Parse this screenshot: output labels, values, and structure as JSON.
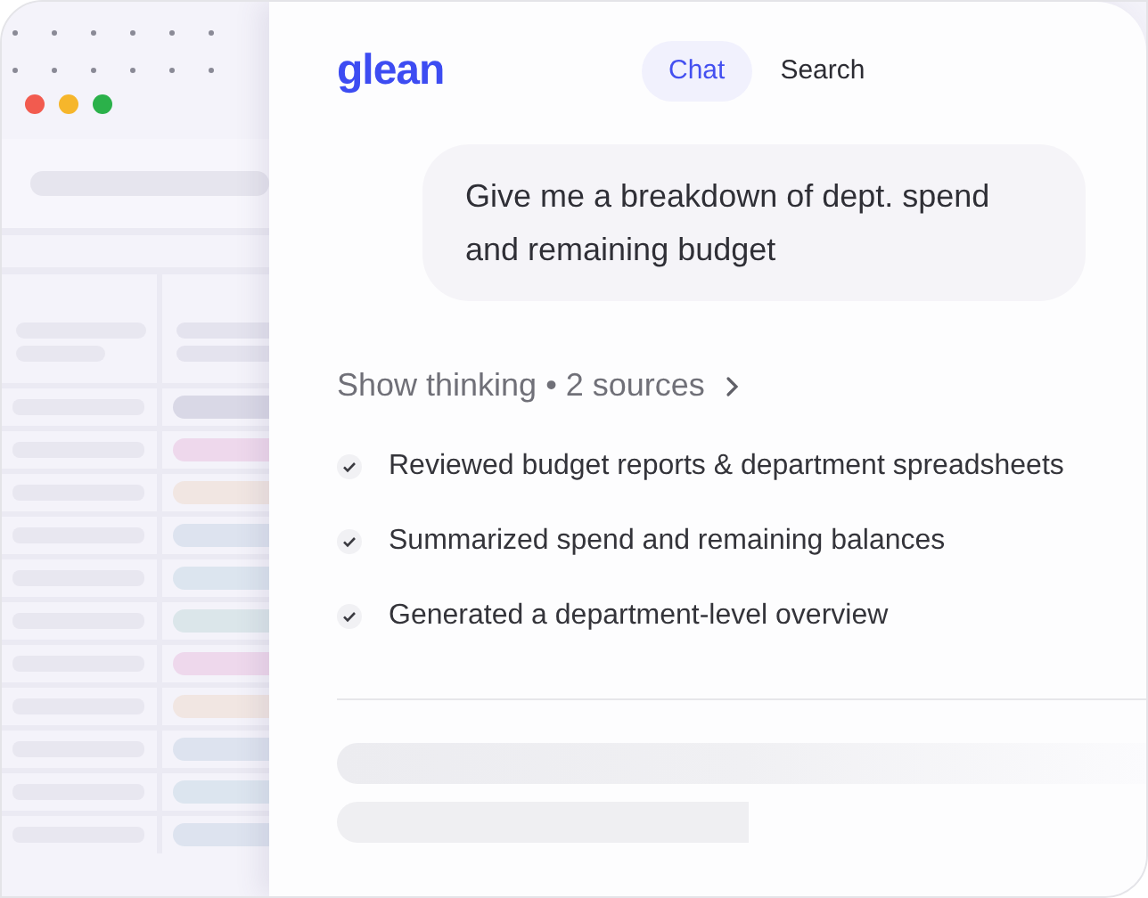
{
  "logo": "glean",
  "tabs": [
    {
      "label": "Chat",
      "selected": true
    },
    {
      "label": "Search",
      "selected": false
    }
  ],
  "prompt": "Give me a breakdown of dept. spend and remaining budget",
  "thinking": {
    "label": "Show thinking • 2 sources",
    "steps": [
      {
        "text": "Reviewed budget reports & department spreadsheets",
        "checked": true
      },
      {
        "text": "Summarized spend and remaining balances",
        "checked": true
      },
      {
        "text": "Generated a department-level overview",
        "checked": true
      }
    ]
  },
  "background_sheet": {
    "rows": [
      {
        "color": "#d9d8e6"
      },
      {
        "color": "#eed8ec"
      },
      {
        "color": "#f1e6e2"
      },
      {
        "color": "#dde3ef"
      },
      {
        "color": "#dce5ef"
      },
      {
        "color": "#dbe6ea"
      },
      {
        "color": "#eed8ec"
      },
      {
        "color": "#f1e6e2"
      },
      {
        "color": "#dde3ef"
      },
      {
        "color": "#dce5ef"
      },
      {
        "color": "#dde3ef"
      }
    ]
  }
}
